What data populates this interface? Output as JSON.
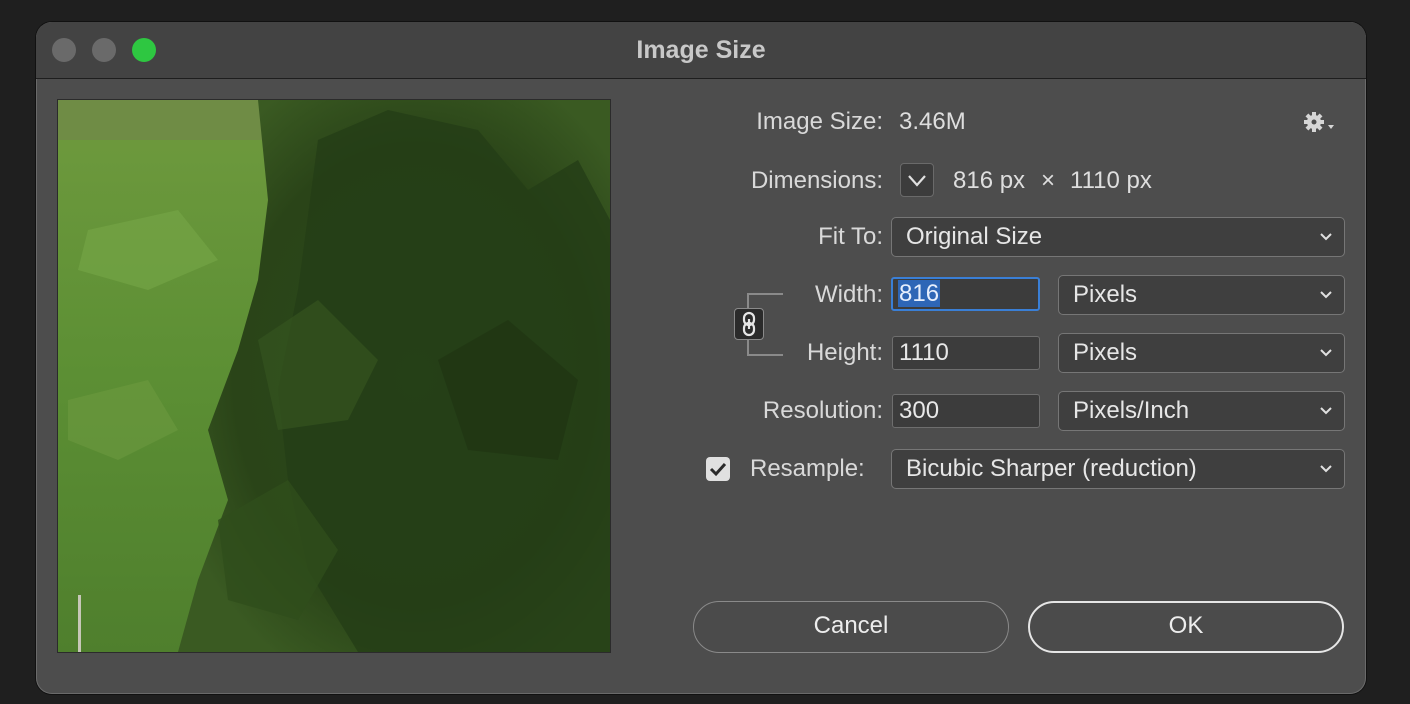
{
  "window": {
    "title": "Image Size"
  },
  "info": {
    "image_size_label": "Image Size:",
    "image_size_value": "3.46M",
    "dimensions_label": "Dimensions:",
    "dim_width": "816 px",
    "dim_times": "×",
    "dim_height": "1110 px"
  },
  "fit_to": {
    "label": "Fit To:",
    "value": "Original Size"
  },
  "width": {
    "label": "Width:",
    "value": "816",
    "unit": "Pixels"
  },
  "height": {
    "label": "Height:",
    "value": "1110",
    "unit": "Pixels"
  },
  "resolution": {
    "label": "Resolution:",
    "value": "300",
    "unit": "Pixels/Inch"
  },
  "resample": {
    "label": "Resample:",
    "checked": true,
    "value": "Bicubic Sharper (reduction)"
  },
  "buttons": {
    "cancel": "Cancel",
    "ok": "OK"
  },
  "colors": {
    "window_bg": "#4d4d4d",
    "zoom_button": "#2ec741",
    "focus_ring": "#3a7fd6",
    "selection": "#2e66b6"
  },
  "icons": {
    "settings": "gear-icon",
    "constrain": "chain-link-icon",
    "expand_dimensions": "chevron-down-icon",
    "resample_check": "checkmark-icon"
  }
}
